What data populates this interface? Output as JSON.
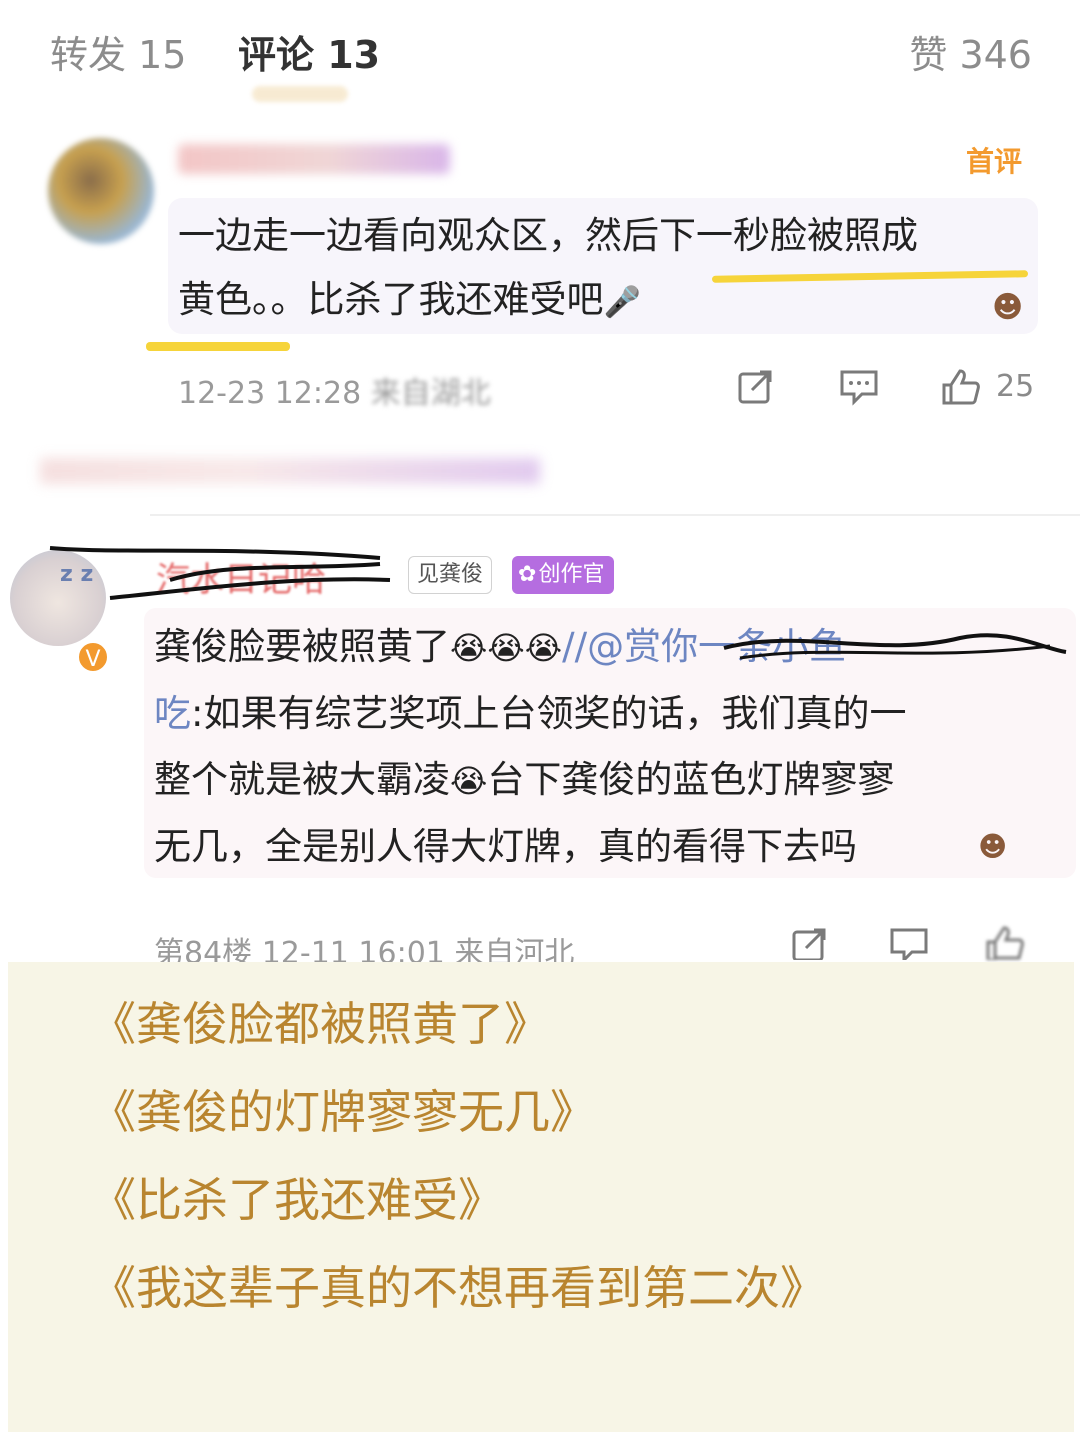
{
  "tabs": {
    "repost": "转发 15",
    "comments": "评论 13",
    "likes": "赞 346"
  },
  "comment1": {
    "badge": "首评",
    "text_line1": "一边走一边看向观众区，然后下一秒脸被照成",
    "text_line2": "黄色。。比杀了我还难受吧",
    "time": "12-23 12:28",
    "location_blurred": "来自湖北",
    "like_count": "25"
  },
  "comment2": {
    "username": "汽水日记哈",
    "fan_badge": "见龚俊",
    "creator_badge": "创作官",
    "line1_main": "龚俊脸要被照黄了",
    "line1_mention": "//@赏你一条小鱼",
    "line2_mention": "吃",
    "line2_main": ":如果有综艺奖项上台领奖的话，我们真的一",
    "line3_a": "整个就是被大霸凌",
    "line3_b": "台下龚俊的蓝色灯牌寥寥",
    "line4": "无几，全是别人得大灯牌，真的看得下去吗",
    "meta": "第84楼 12-11 16:01 来自河北"
  },
  "quotes": [
    "《龚俊脸都被照黄了》",
    "《龚俊的灯牌寥寥无几》",
    "《比杀了我还难受》",
    "《我这辈子真的不想再看到第二次》"
  ],
  "colors": {
    "quote_text": "#b9852f",
    "panel_bg": "#f7f5e6",
    "highlight": "#f6d43a",
    "first_badge": "#f39a2e",
    "creator_badge": "#b56de0"
  },
  "icons": {
    "share": "share-icon",
    "reply": "comment-icon",
    "like": "thumbs-up-icon",
    "emoji": "crying-face-icon"
  }
}
